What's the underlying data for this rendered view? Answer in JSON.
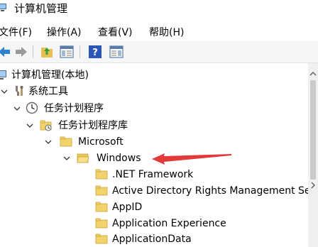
{
  "window": {
    "title": "计算机管理"
  },
  "menu": [
    {
      "label": "文件(F)"
    },
    {
      "label": "操作(A)"
    },
    {
      "label": "查看(V)"
    },
    {
      "label": "帮助(H)"
    }
  ],
  "toolbar": {
    "buttons": [
      "back-arrow-icon",
      "forward-arrow-icon",
      "up-folder-icon",
      "show-hide-tree-icon",
      "help-icon",
      "action-pane-icon"
    ]
  },
  "tree": {
    "root": "计算机管理(本地)",
    "system_tools": "系统工具",
    "task_scheduler": "任务计划程序",
    "task_scheduler_library": "任务计划程序库",
    "microsoft": "Microsoft",
    "windows": "Windows",
    "children": [
      ".NET Framework",
      "Active Directory Rights Management Services Client",
      "AppID",
      "Application Experience",
      "ApplicationData"
    ]
  },
  "colors": {
    "annotation_arrow": "#e23a3a",
    "folder_yellow": "#f2d36b"
  }
}
